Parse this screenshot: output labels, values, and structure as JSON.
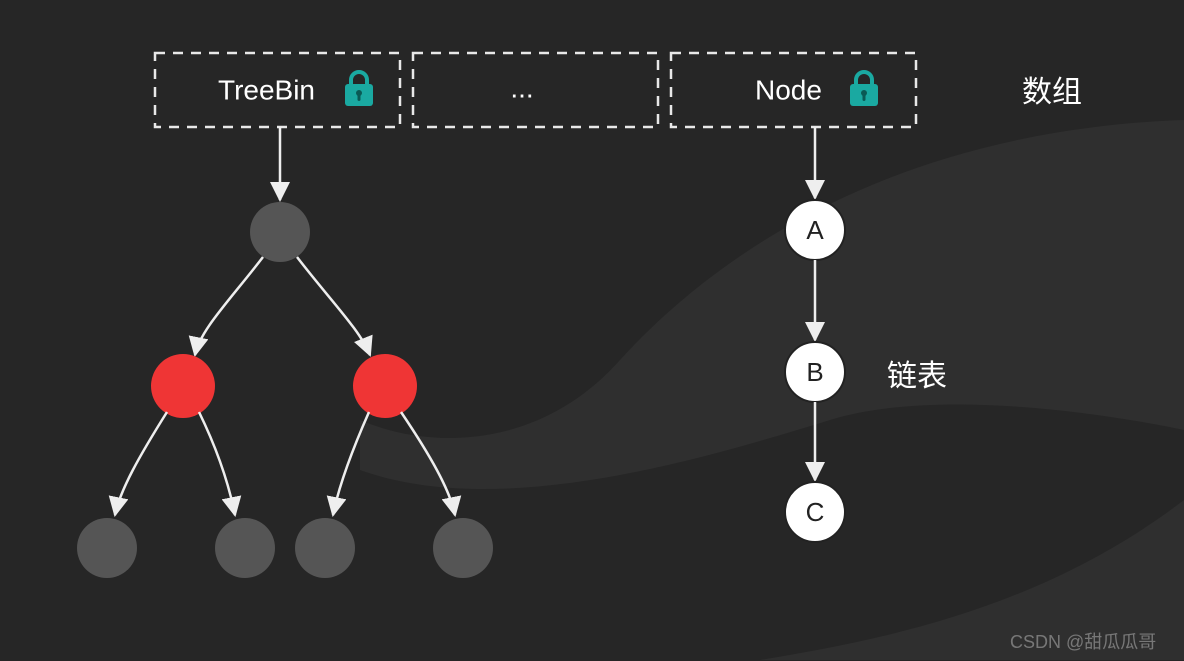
{
  "labels": {
    "array_label": "数组",
    "list_label": "链表",
    "watermark": "CSDN @甜瓜瓜哥"
  },
  "slots": {
    "treebin": {
      "label": "TreeBin",
      "locked": true
    },
    "middle": {
      "label": "...",
      "locked": false
    },
    "node": {
      "label": "Node",
      "locked": true
    }
  },
  "linked_list": {
    "nodes": [
      "A",
      "B",
      "C"
    ]
  },
  "tree": {
    "root_color": "dark",
    "children": [
      {
        "color": "red",
        "children": [
          {
            "color": "dark"
          },
          {
            "color": "dark"
          }
        ]
      },
      {
        "color": "red",
        "children": [
          {
            "color": "dark"
          },
          {
            "color": "dark"
          }
        ]
      }
    ]
  },
  "colors": {
    "bg": "#262626",
    "node_dark": "#555555",
    "node_red": "#ef3535",
    "lock_teal": "#1aa9a1"
  }
}
